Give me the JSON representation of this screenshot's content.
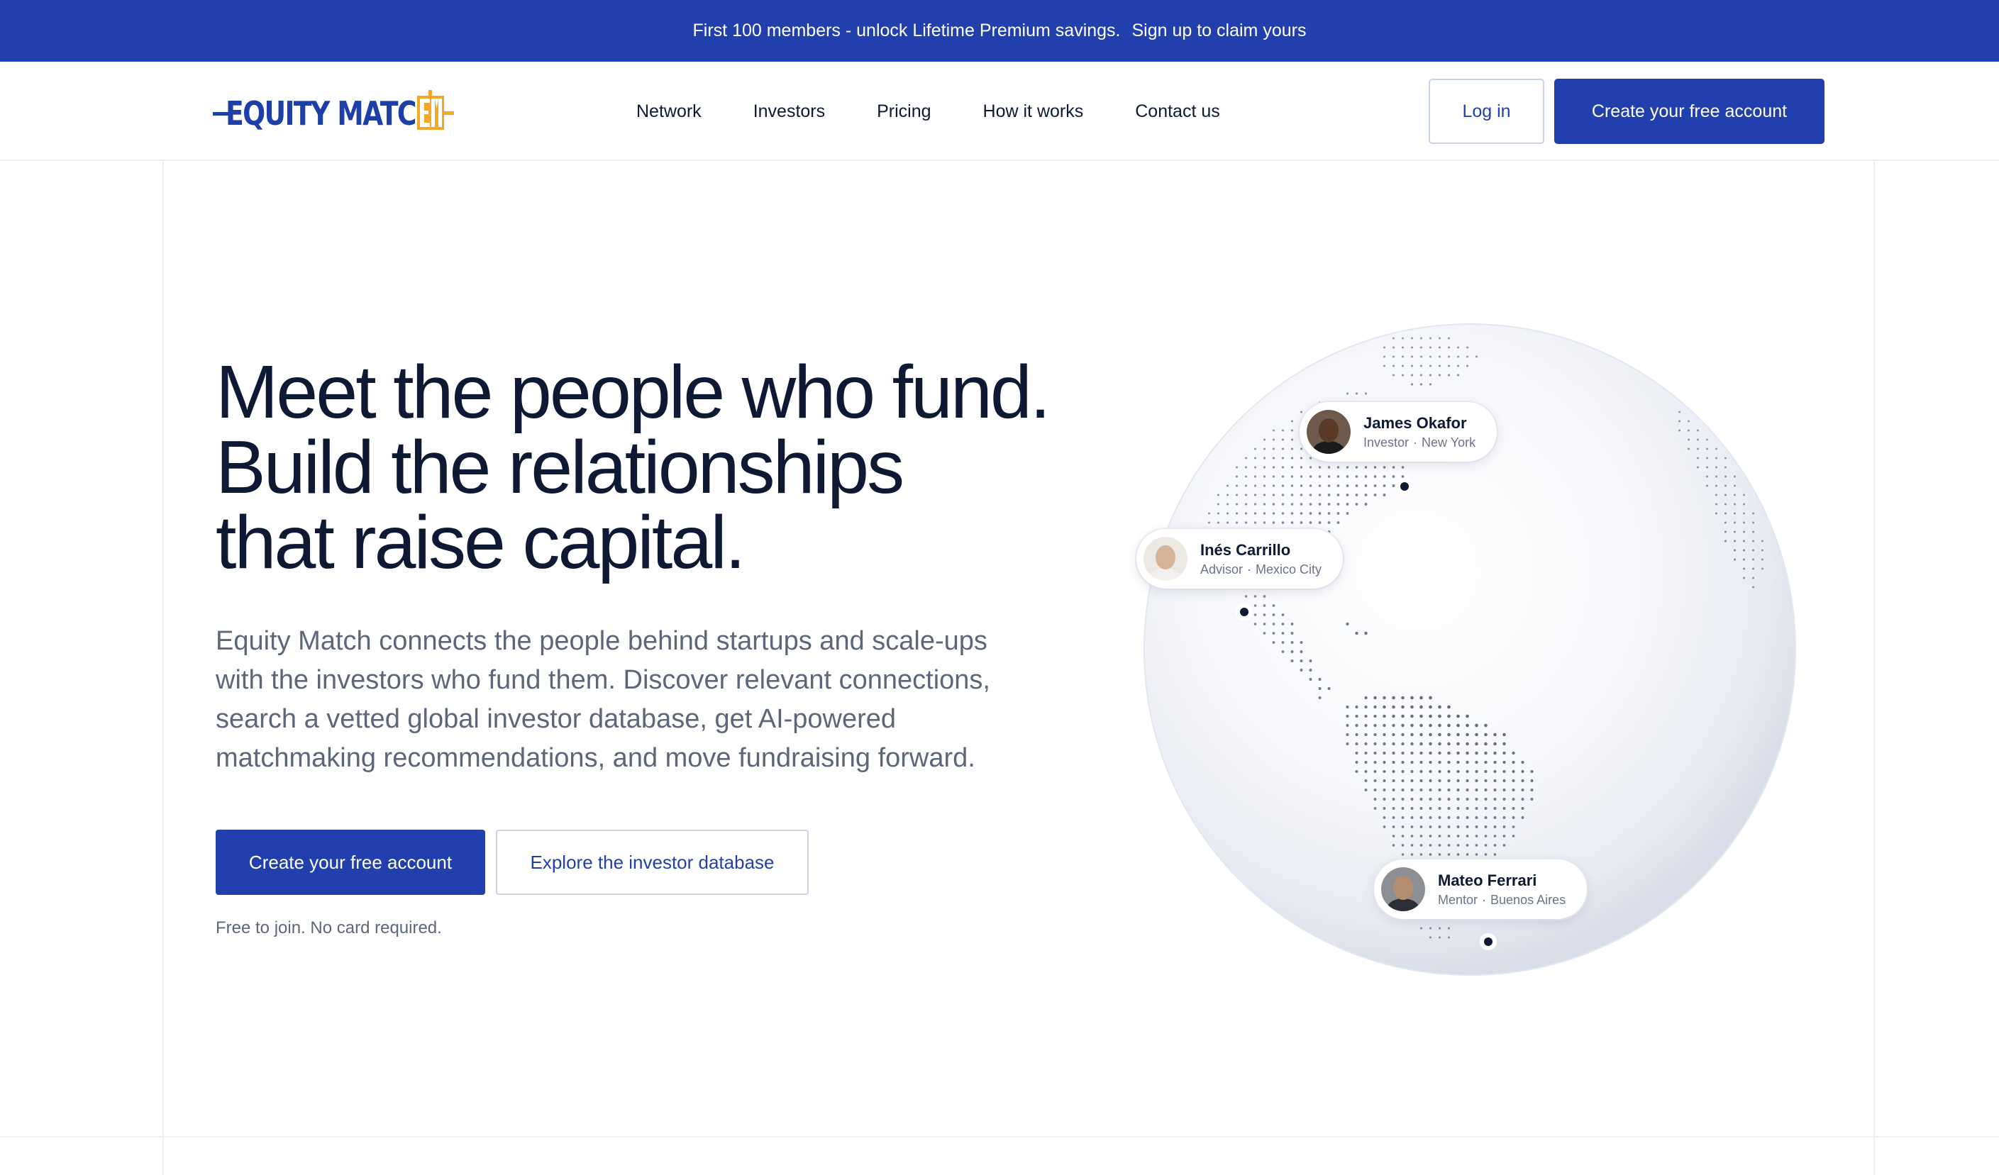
{
  "promo": {
    "text": "First 100 members - unlock Lifetime Premium savings.",
    "link": "Sign up to claim yours"
  },
  "brand": {
    "name": "EQUITY MATCH",
    "mark": "EM",
    "colors": {
      "primary": "#2240ad",
      "logo_blue": "#1c3fa8",
      "logo_orange": "#f5a623"
    }
  },
  "nav": {
    "items": [
      "Network",
      "Investors",
      "Pricing",
      "How it works",
      "Contact us"
    ],
    "login_label": "Log in",
    "create_label": "Create your free account"
  },
  "hero": {
    "title_lines": [
      "Meet the people who fund.",
      "Build the relationships",
      "that raise capital."
    ],
    "description": "Equity Match connects the people behind startups and scale-ups with the investors who fund them. Discover relevant connections, search a vetted global investor database, get AI-powered matchmaking recommendations, and move fundraising forward.",
    "cta_primary": "Create your free account",
    "cta_secondary": "Explore the investor database",
    "fine_print": "Free to join. No card required."
  },
  "globe": {
    "people": [
      {
        "name": "James Okafor",
        "role": "Investor",
        "city": "New York"
      },
      {
        "name": "Inés Carrillo",
        "role": "Advisor",
        "city": "Mexico City"
      },
      {
        "name": "Mateo Ferrari",
        "role": "Mentor",
        "city": "Buenos Aires"
      }
    ]
  }
}
